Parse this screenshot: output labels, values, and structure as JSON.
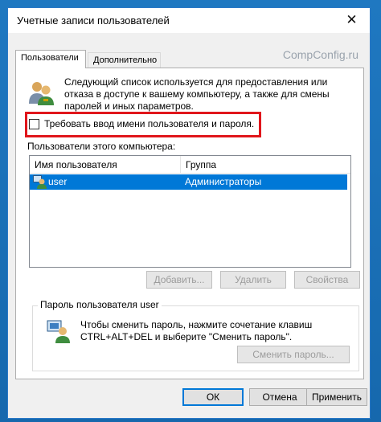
{
  "window": {
    "title": "Учетные записи пользователей",
    "watermark": "CompConfig.ru"
  },
  "tabs": [
    {
      "label": "Пользователи",
      "active": true
    },
    {
      "label": "Дополнительно",
      "active": false
    }
  ],
  "description": "Следующий список используется для предоставления или отказа в доступе к вашему компьютеру, а также для смены паролей и иных параметров.",
  "checkbox": {
    "label": "Требовать ввод имени пользователя и пароля.",
    "checked": false
  },
  "users_list": {
    "label": "Пользователи этого компьютера:",
    "columns": [
      "Имя пользователя",
      "Группа"
    ],
    "rows": [
      {
        "user": "user",
        "group": "Администраторы",
        "selected": true
      }
    ]
  },
  "list_buttons": {
    "add": "Добавить...",
    "remove": "Удалить",
    "properties": "Свойства"
  },
  "password_group": {
    "title": "Пароль пользователя user",
    "text": "Чтобы сменить пароль, нажмите сочетание клавиш CTRL+ALT+DEL и выберите \"Сменить пароль\".",
    "button": "Сменить пароль..."
  },
  "dialog_buttons": {
    "ok": "ОК",
    "cancel": "Отмена",
    "apply": "Применить"
  },
  "colors": {
    "accent": "#0078d7",
    "highlight_border": "#e0161b"
  }
}
